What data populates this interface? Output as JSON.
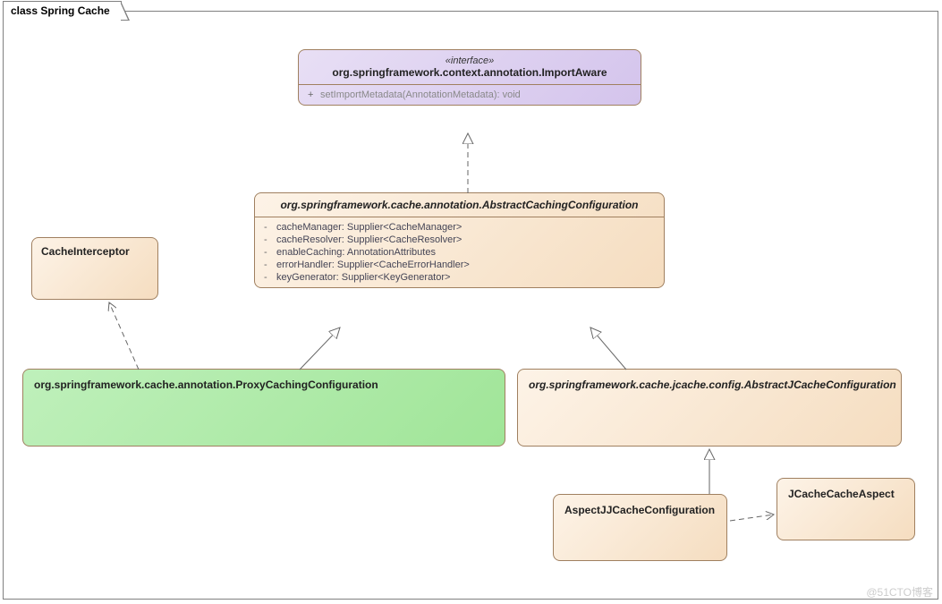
{
  "diagram": {
    "title": "class Spring Cache",
    "watermark": "@51CTO博客"
  },
  "interface": {
    "stereotype": "«interface»",
    "name": "org.springframework.context.annotation.ImportAware",
    "method_vis": "+",
    "method": "setImportMetadata(AnnotationMetadata): void"
  },
  "absCaching": {
    "name": "org.springframework.cache.annotation.AbstractCachingConfiguration",
    "f1_vis": "-",
    "f1": "cacheManager: Supplier<CacheManager>",
    "f2_vis": "-",
    "f2": "cacheResolver: Supplier<CacheResolver>",
    "f3_vis": "-",
    "f3": "enableCaching: AnnotationAttributes",
    "f4_vis": "-",
    "f4": "errorHandler: Supplier<CacheErrorHandler>",
    "f5_vis": "-",
    "f5": "keyGenerator: Supplier<KeyGenerator>"
  },
  "cacheInterceptor": {
    "name": "CacheInterceptor"
  },
  "proxyCaching": {
    "name": "org.springframework.cache.annotation.ProxyCachingConfiguration"
  },
  "absJCache": {
    "name": "org.springframework.cache.jcache.config.AbstractJCacheConfiguration"
  },
  "aspectJJCache": {
    "name": "AspectJJCacheConfiguration"
  },
  "jcacheAspect": {
    "name": "JCacheCacheAspect"
  }
}
